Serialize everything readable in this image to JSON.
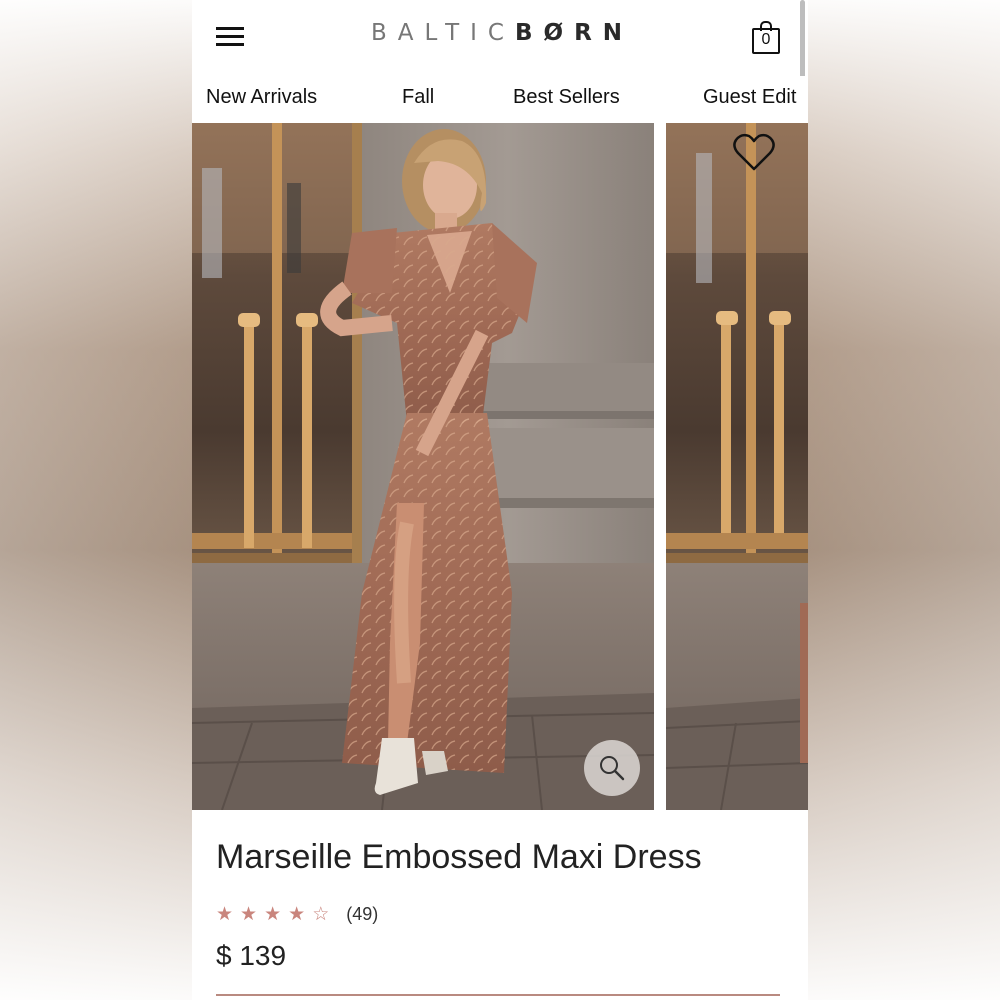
{
  "header": {
    "logo_light": "BALTIC",
    "logo_bold": "BØRN",
    "cart_count": "0"
  },
  "nav": {
    "items": [
      {
        "label": "New Arrivals"
      },
      {
        "label": "Fall"
      },
      {
        "label": "Best Sellers"
      },
      {
        "label": "Guest Edit"
      }
    ]
  },
  "product": {
    "title": "Marseille Embossed Maxi Dress",
    "rating": 4,
    "rating_max": 5,
    "review_count": "(49)",
    "price": "$ 139"
  },
  "colors": {
    "accent": "#c9857d",
    "dress": "#a8735e",
    "underline": "#b98a80"
  },
  "icons": {
    "menu": "hamburger-menu-icon",
    "cart": "shopping-bag-icon",
    "wishlist": "heart-outline-icon",
    "zoom": "magnifier-icon"
  }
}
